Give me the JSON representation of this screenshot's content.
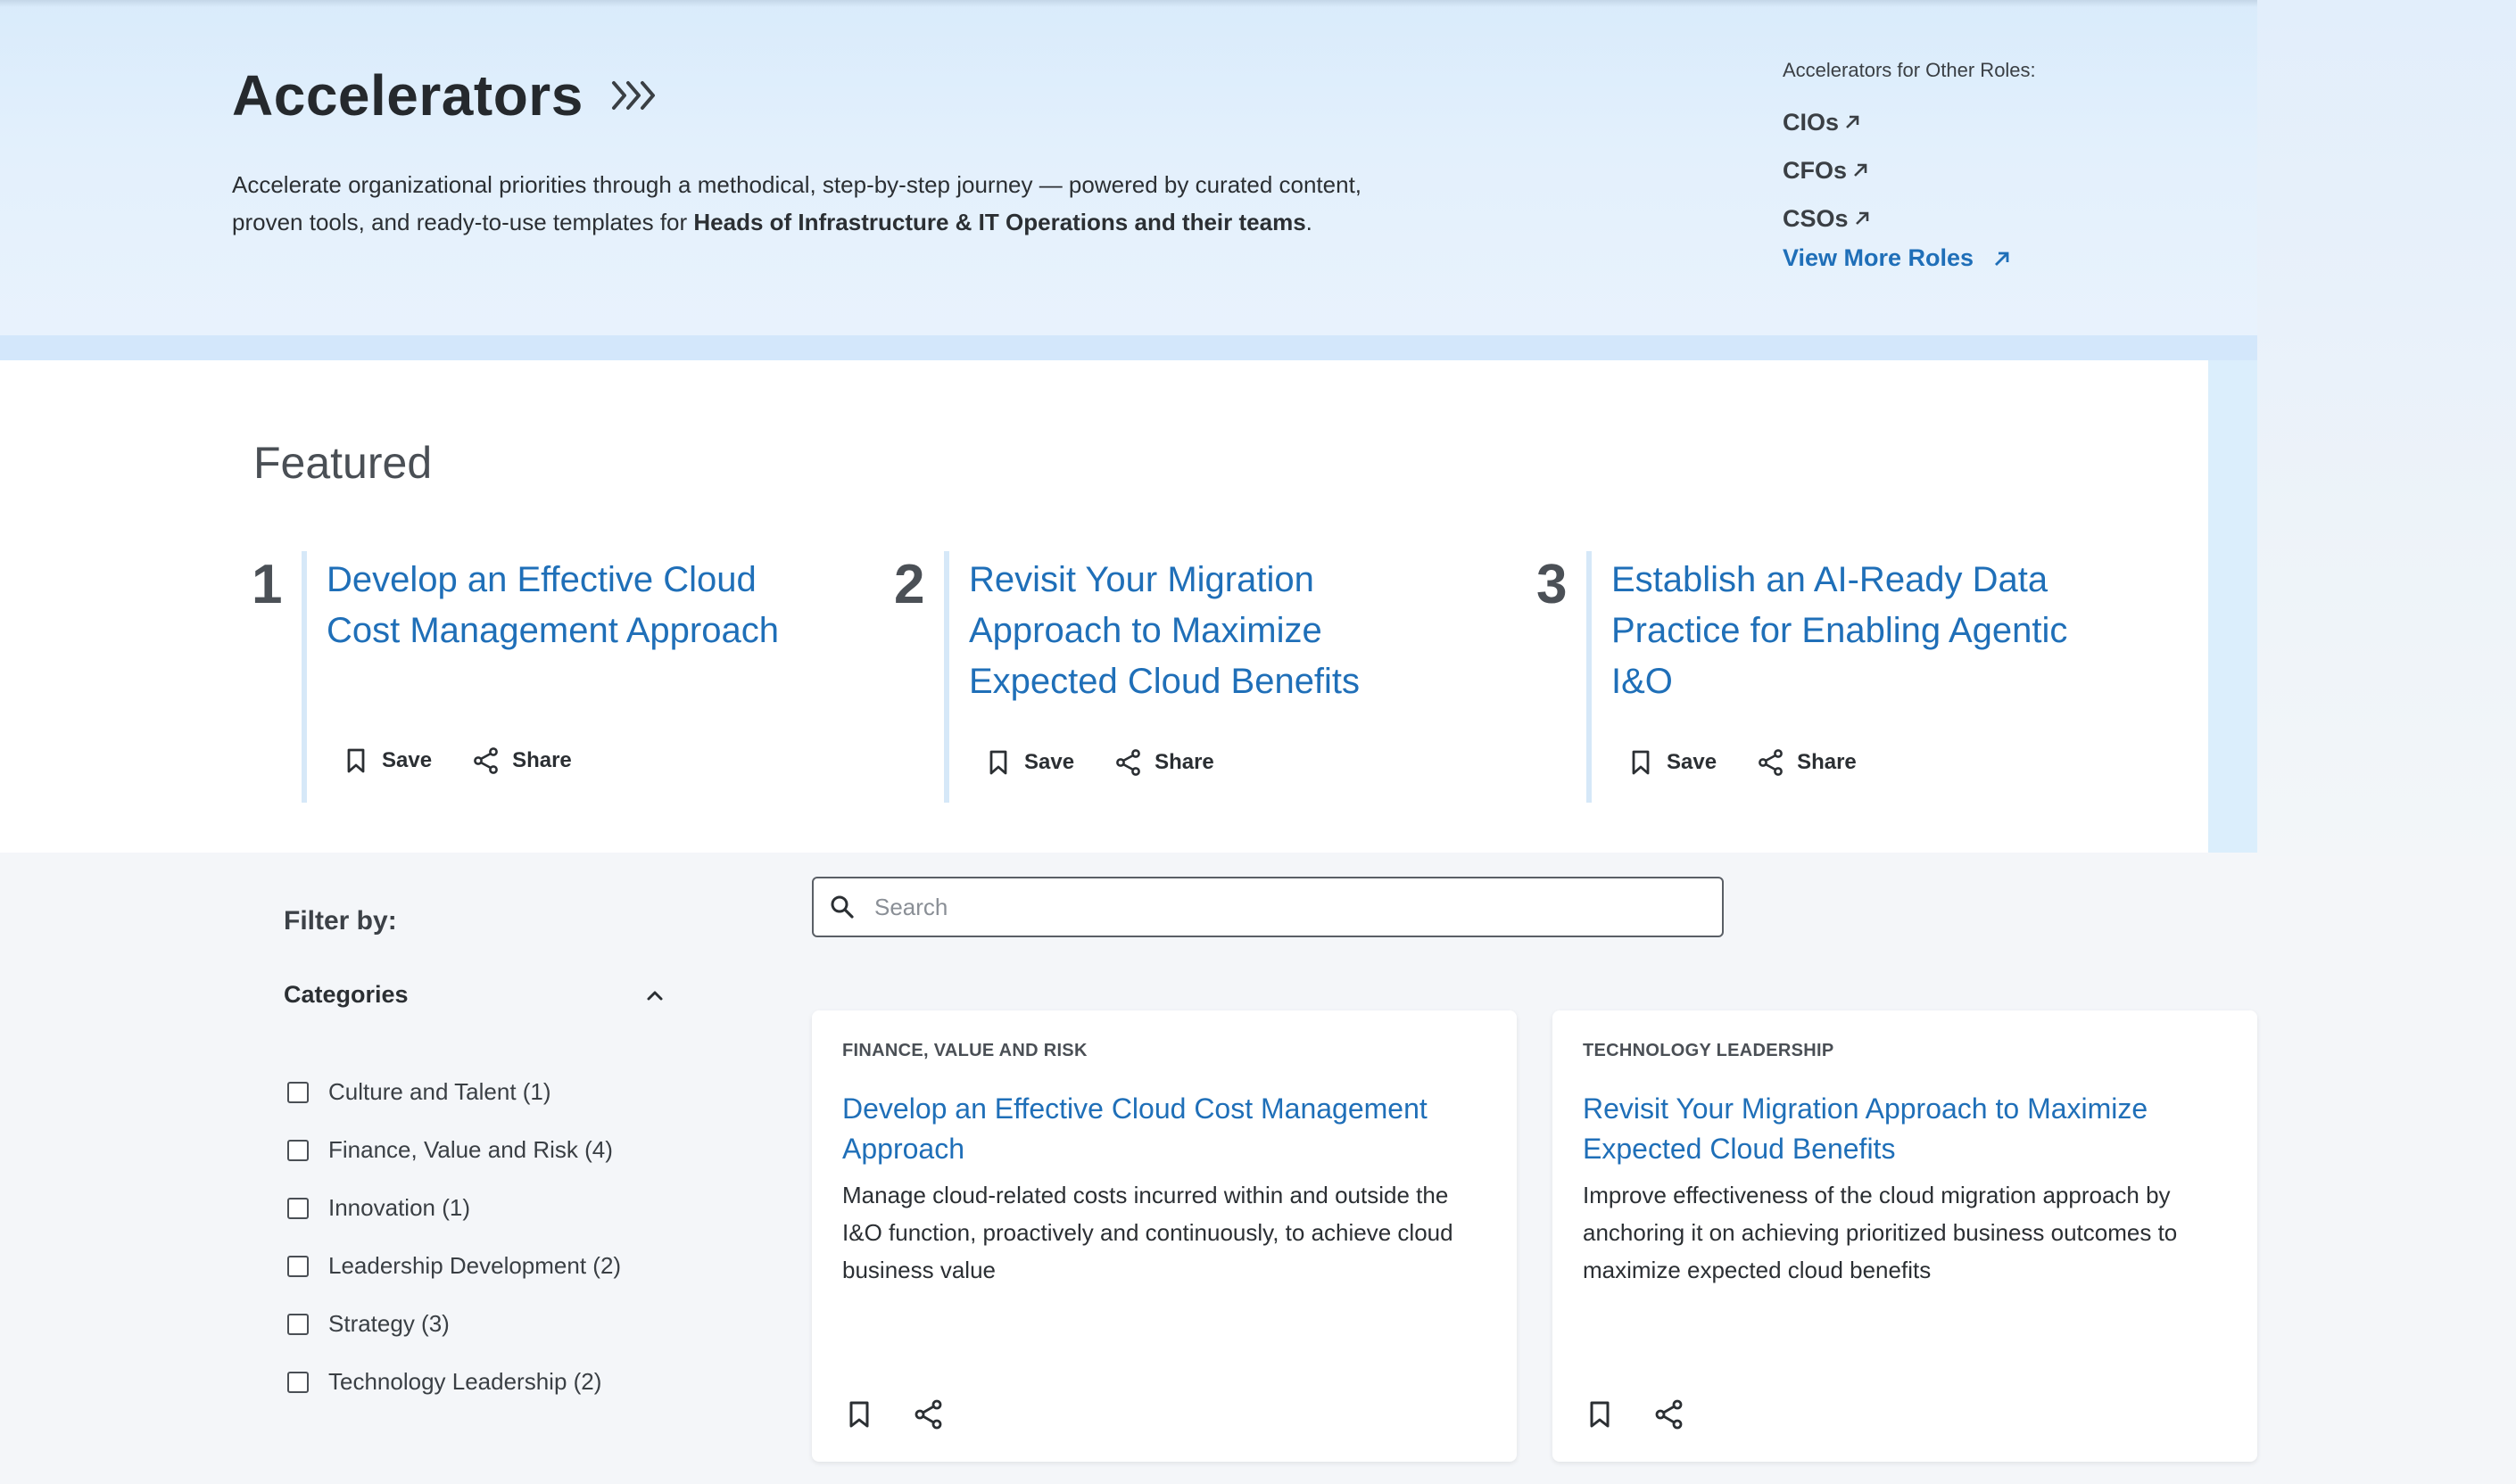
{
  "header": {
    "title": "Accelerators",
    "intro_plain": "Accelerate organizational priorities through a methodical, step-by-step journey — powered by curated content, proven tools, and ready-to-use templates for ",
    "intro_bold": "Heads of Infrastructure & IT Operations and their teams",
    "intro_end": "."
  },
  "other_roles": {
    "label": "Accelerators for Other Roles:",
    "links": [
      "CIOs",
      "CFOs",
      "CSOs"
    ],
    "view_more": "View More Roles"
  },
  "featured": {
    "title": "Featured",
    "items": [
      {
        "num": "1",
        "title": "Develop an Effective Cloud Cost Management Approach",
        "save": "Save",
        "share": "Share"
      },
      {
        "num": "2",
        "title": "Revisit Your Migration Approach to Maximize Expected Cloud Benefits",
        "save": "Save",
        "share": "Share"
      },
      {
        "num": "3",
        "title": "Establish an AI-Ready Data Practice for Enabling Agentic I&O",
        "save": "Save",
        "share": "Share"
      }
    ]
  },
  "filter": {
    "title": "Filter by:",
    "categories_title": "Categories",
    "categories": [
      "Culture and Talent (1)",
      "Finance, Value and Risk (4)",
      "Innovation (1)",
      "Leadership Development (2)",
      "Strategy (3)",
      "Technology Leadership (2)"
    ]
  },
  "search": {
    "placeholder": "Search",
    "value": ""
  },
  "cards": [
    {
      "category": "FINANCE, VALUE AND RISK",
      "title": "Develop an Effective Cloud Cost Management Approach",
      "description": "Manage cloud-related costs incurred within and outside the I&O function, proactively and continuously, to achieve cloud business value"
    },
    {
      "category": "TECHNOLOGY LEADERSHIP",
      "title": "Revisit Your Migration Approach to Maximize Expected Cloud Benefits",
      "description": "Improve effectiveness of the cloud migration approach by anchoring it on achieving prioritized business outcomes to maximize expected cloud benefits"
    }
  ],
  "colors": {
    "link": "#1f6fb8",
    "hero_bg": "#deedfb",
    "featured_border": "#d3e7fb"
  },
  "icons": [
    "chevrons-right-icon",
    "arrow-up-right-icon",
    "bookmark-icon",
    "share-icon",
    "search-icon",
    "chevron-up-icon",
    "checkbox-icon"
  ]
}
